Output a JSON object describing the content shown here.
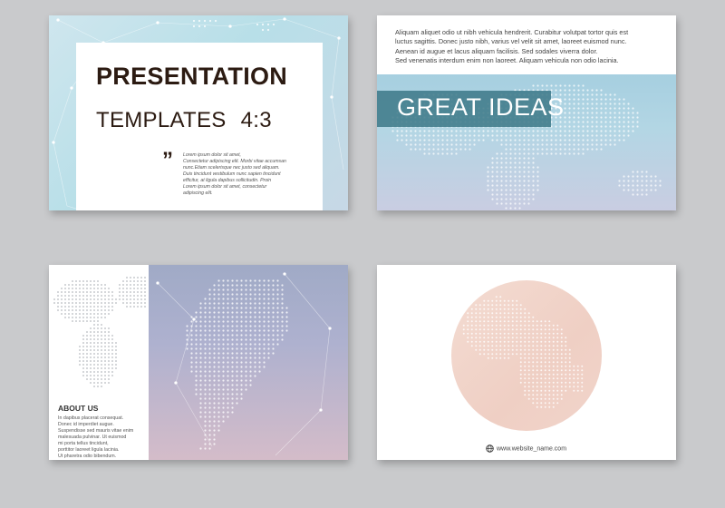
{
  "slide1": {
    "title_line1": "PRESENTATION",
    "title_line2": "TEMPLATES",
    "ratio": "4:3",
    "quote_mark": "”",
    "body_lines": [
      "Lorem ipsum dolor sit amet,",
      "Consectetur adipiscing elit. Morbi vitae accumsan",
      "nunc.Etiam scelerisque nec justo sed aliquam.",
      "Duis tincidunt vestibulum nunc sapien tincidunt",
      "efficitur, at ligula dapibus sollicitudin. Proin",
      "Lorem ipsum dolor sit amet, consectetur",
      "adipiscing elit."
    ]
  },
  "slide2": {
    "lines": [
      "Aliquam aliquet odio ut nibh vehicula hendrerit. Curabitur volutpat tortor quis est",
      "luctus sagittis. Donec justo nibh, varius vel velit sit amet, laoreet euismod nunc.",
      "Aenean id augue et lacus aliquam facilisis. Sed sodales viverra dolor.",
      "Sed venenatis interdum enim non laoreet. Aliquam vehicula non odio lacinia."
    ],
    "band_title": "GREAT IDEAS"
  },
  "slide3": {
    "heading": "ABOUT US",
    "body_lines": [
      "In dapibus placerat consequat.",
      "Donec id imperdiet augue.",
      "Suspendisse sed mauris vitae enim",
      "malesuada pulvinar. Ut euismod",
      "mi porta tellus tincidunt,",
      "porttitor laoreet ligula lacinia.",
      "Ut pharetra odio bibendum."
    ]
  },
  "slide4": {
    "website": "www.website_name.com",
    "icon": "globe-icon"
  },
  "colors": {
    "background": "#c9cacc",
    "band": "#3c7887",
    "title": "#2c1b12"
  }
}
